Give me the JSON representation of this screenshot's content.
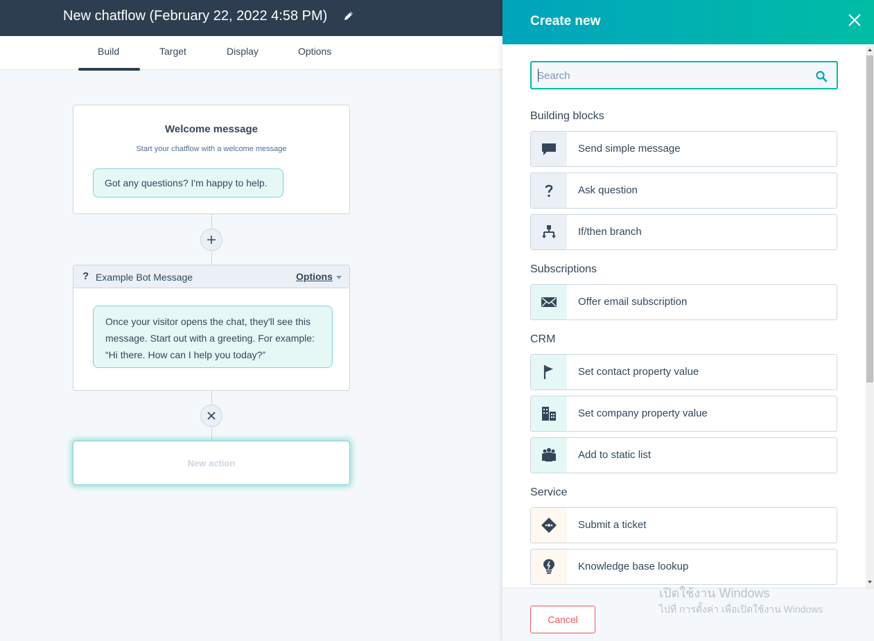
{
  "header": {
    "title": "New chatflow (February 22, 2022 4:58 PM)",
    "edit_icon": "pencil-icon"
  },
  "tabs": [
    {
      "label": "Build",
      "active": true
    },
    {
      "label": "Target",
      "active": false
    },
    {
      "label": "Display",
      "active": false
    },
    {
      "label": "Options",
      "active": false
    }
  ],
  "canvas": {
    "welcome": {
      "title": "Welcome message",
      "subtitle": "Start your chatflow with a welcome message",
      "bubble": "Got any questions? I'm happy to help."
    },
    "add_button_icon": "plus-icon",
    "bot_message": {
      "icon": "?",
      "label": "Example Bot Message",
      "options_label": "Options",
      "bubble_lines": [
        "Once your visitor opens the chat, they'll see this",
        "message. Start out with a greeting. For example:",
        "“Hi there. How can I help you today?”"
      ]
    },
    "remove_button_icon": "close-icon",
    "new_action_label": "New action"
  },
  "panel": {
    "title": "Create new",
    "close_icon": "close-icon",
    "search": {
      "placeholder": "Search",
      "value": ""
    },
    "sections": [
      {
        "title": "Building blocks",
        "items": [
          {
            "label": "Send simple message",
            "icon": "chat-bubble-icon",
            "tint": "blue"
          },
          {
            "label": "Ask question",
            "icon": "question-mark-icon",
            "tint": "blue"
          },
          {
            "label": "If/then branch",
            "icon": "branch-icon",
            "tint": "blue"
          }
        ]
      },
      {
        "title": "Subscriptions",
        "items": [
          {
            "label": "Offer email subscription",
            "icon": "envelope-icon",
            "tint": "teal"
          }
        ]
      },
      {
        "title": "CRM",
        "items": [
          {
            "label": "Set contact property value",
            "icon": "flag-icon",
            "tint": "teal"
          },
          {
            "label": "Set company property value",
            "icon": "building-icon",
            "tint": "teal"
          },
          {
            "label": "Add to static list",
            "icon": "people-icon",
            "tint": "teal"
          }
        ]
      },
      {
        "title": "Service",
        "items": [
          {
            "label": "Submit a ticket",
            "icon": "ticket-icon",
            "tint": "orange"
          },
          {
            "label": "Knowledge base lookup",
            "icon": "lightbulb-icon",
            "tint": "orange"
          }
        ]
      }
    ],
    "cancel_label": "Cancel"
  },
  "colors": {
    "nav_dark": "#2d3e50",
    "accent_teal": "#00bda5",
    "accent_cyan": "#00a4bd",
    "cancel_red": "#f2545b",
    "text": "#33475b"
  },
  "watermark": {
    "line1": "เปิดใช้งาน Windows",
    "line2": "ไปที่ การตั้งค่า เพื่อเปิดใช้งาน Windows"
  }
}
